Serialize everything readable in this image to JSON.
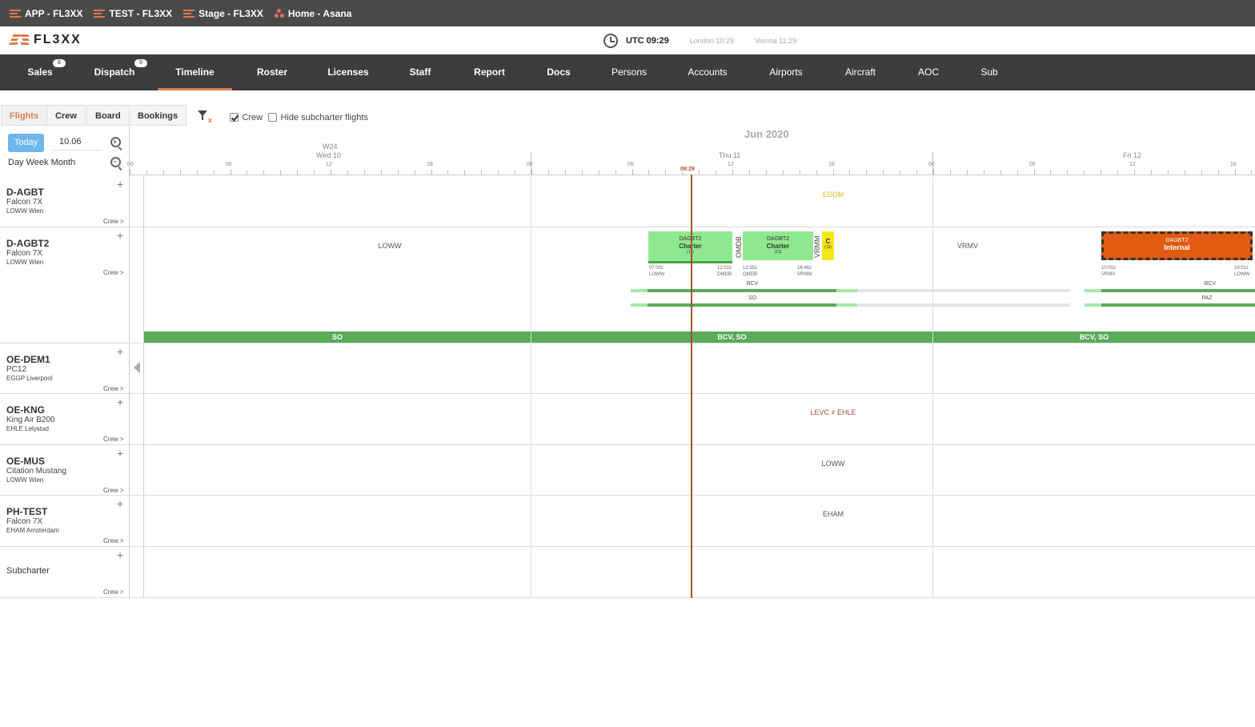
{
  "bookmarks": [
    {
      "label": "APP - FL3XX",
      "icon": "fl3xx-logo-icon"
    },
    {
      "label": "TEST - FL3XX",
      "icon": "fl3xx-logo-icon"
    },
    {
      "label": "Stage - FL3XX",
      "icon": "fl3xx-logo-icon"
    },
    {
      "label": "Home - Asana",
      "icon": "asana-icon"
    }
  ],
  "header": {
    "logo_text": "FL3XX",
    "utc": "UTC 09:29",
    "london": "London 10:29",
    "vienna": "Vienna 11:29"
  },
  "nav": [
    {
      "label": "Sales",
      "badge": "8"
    },
    {
      "label": "Dispatch",
      "badge": "9"
    },
    {
      "label": "Timeline"
    },
    {
      "label": "Roster"
    },
    {
      "label": "Licenses"
    },
    {
      "label": "Staff"
    },
    {
      "label": "Report"
    },
    {
      "label": "Docs"
    },
    {
      "label": "Persons"
    },
    {
      "label": "Accounts"
    },
    {
      "label": "Airports"
    },
    {
      "label": "Aircraft"
    },
    {
      "label": "AOC"
    },
    {
      "label": "Sub"
    }
  ],
  "subtabs": [
    "Flights",
    "Crew",
    "Board",
    "Bookings"
  ],
  "filters": {
    "crew": "Crew",
    "hide_sub": "Hide subcharter flights",
    "filter_clear": "x"
  },
  "controls": {
    "today": "Today",
    "date": "10.06",
    "range": "Day Week Month",
    "zoom_in": "+",
    "zoom_out": "−"
  },
  "timeline": {
    "month": "Jun 2020",
    "week": "W24",
    "days": [
      "Wed 10",
      "Thu 11",
      "Fri 12"
    ],
    "hours": [
      "00",
      "06",
      "12",
      "18",
      "00",
      "06",
      "12",
      "18",
      "00",
      "06",
      "12",
      "18"
    ],
    "now": "09:29"
  },
  "rows": [
    {
      "reg": "D-AGBT",
      "type": "Falcon 7X",
      "base": "LOWW Wien",
      "crew": "Crew >",
      "airport": "EDDM"
    },
    {
      "reg": "D-AGBT2",
      "type": "Falcon 7X",
      "base": "LOWW Wien",
      "crew": "Crew >",
      "airport_a": "LOWW",
      "airport_b": "VRMV"
    },
    {
      "reg": "OE-DEM1",
      "type": "PC12",
      "base": "EGGP Liverpool",
      "crew": "Crew >"
    },
    {
      "reg": "OE-KNG",
      "type": "King Air B200",
      "base": "EHLE Lelystad",
      "crew": "Crew >",
      "airport": "LEVC ≠ EHLE"
    },
    {
      "reg": "OE-MUS",
      "type": "Citation Mustang",
      "base": "LOWW Wien",
      "crew": "Crew >",
      "airport": "LOWW"
    },
    {
      "reg": "PH-TEST",
      "type": "Falcon 7X",
      "base": "EHAM Amsterdam",
      "crew": "Crew >",
      "airport": "EHAM"
    },
    {
      "reg": "",
      "type": "Subcharter",
      "base": "",
      "crew": "Crew >"
    }
  ],
  "flights": [
    {
      "id": "DAGBT2",
      "type": "Charter",
      "count": "(13)",
      "dep_time": "07:00z",
      "dep": "LOWW",
      "arr_time": "12:02z",
      "arr": "OMDB"
    },
    {
      "id": "DAGBT2",
      "type": "Charter",
      "count": "(13)",
      "dep_time": "12:35z",
      "dep": "OMDB",
      "arr_time": "16:48z",
      "arr": "VRMM"
    },
    {
      "id": "C",
      "count": "(13)"
    },
    {
      "id": "DAGBT2",
      "type": "Internal",
      "dep_time": "10:00z",
      "dep": "VRMV",
      "arr_time": "19:01z",
      "arr": "LOWW"
    }
  ],
  "vert_labels": [
    "OMDB",
    "VRMM"
  ],
  "crew_names": [
    "BCV",
    "SO",
    "BCV",
    "PAZ"
  ],
  "duty": [
    "SO",
    "BCV, SO",
    "BCV, SO"
  ],
  "colors": {
    "accent": "#e07a4a",
    "flight": "#8ee88e",
    "internal": "#e05a10",
    "duty": "#5aab5a",
    "now": "#a0522d"
  }
}
